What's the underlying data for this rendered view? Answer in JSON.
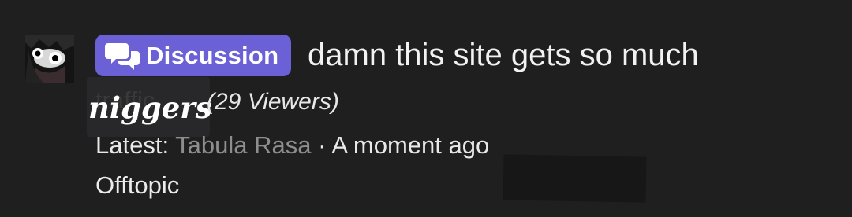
{
  "thread": {
    "badge": {
      "label": "Discussion",
      "icon": "chat-bubbles-icon",
      "color": "#6b60d6"
    },
    "title": "damn this site gets so much",
    "title_cont": "traffic",
    "overlay_caption": "niggers",
    "viewers": "(29 Viewers)",
    "latest_prefix": "Latest:",
    "latest_author": "Tabula Rasa",
    "latest_separator": "·",
    "latest_time": "A moment ago",
    "category": "Offtopic"
  },
  "colors": {
    "background": "#1f1f20",
    "text": "#f2f2f2",
    "muted": "#8e8e8e"
  }
}
